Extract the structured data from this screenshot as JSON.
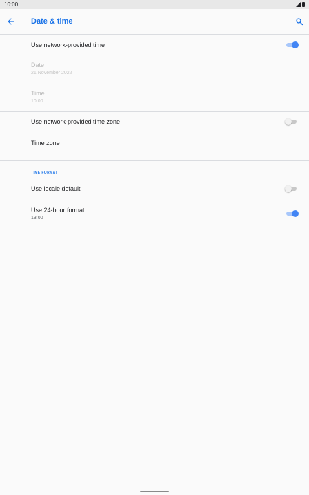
{
  "status_bar": {
    "time": "10:00",
    "icons": [
      "signal-icon",
      "battery-icon"
    ]
  },
  "app_bar": {
    "title": "Date & time",
    "back_icon": "arrow-left-icon",
    "search_icon": "search-icon"
  },
  "settings": {
    "network_time": {
      "title": "Use network-provided time",
      "enabled": true
    },
    "date": {
      "title": "Date",
      "value": "21 November 2022",
      "disabled": true
    },
    "time": {
      "title": "Time",
      "value": "10:00",
      "disabled": true
    },
    "network_time_zone": {
      "title": "Use network-provided time zone",
      "enabled": false
    },
    "time_zone": {
      "title": "Time zone"
    }
  },
  "time_format": {
    "header": "TIME FORMAT",
    "locale_default": {
      "title": "Use locale default",
      "enabled": false
    },
    "hour_24": {
      "title": "Use 24-hour format",
      "value": "13:00",
      "enabled": true
    }
  },
  "colors": {
    "accent": "#1a73e8",
    "switch_on": "#4285f4",
    "switch_track_on": "#a8c7fa"
  }
}
